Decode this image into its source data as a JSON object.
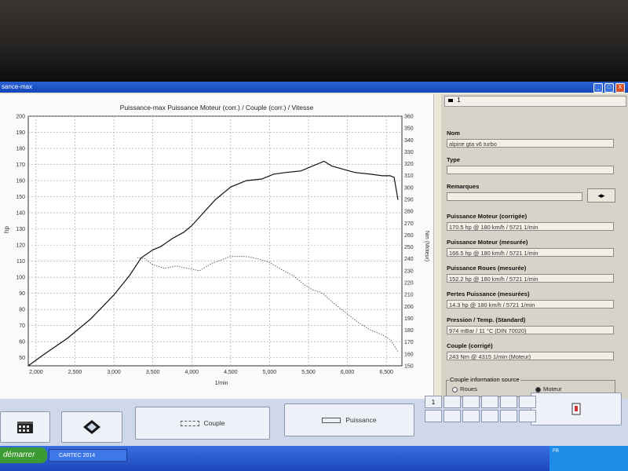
{
  "window": {
    "title": "sance-max",
    "min": "_",
    "max": "□",
    "close": "X"
  },
  "chart_data": {
    "type": "line",
    "title": "Puissance-max Puissance Moteur (corr.) / Couple (corr.) / Vitesse",
    "xlabel": "1/min",
    "ylabel": "hp",
    "y2label": "Nm (Moteur)",
    "xlim": [
      1900,
      6700
    ],
    "ylim": [
      45,
      200
    ],
    "y2lim": [
      150,
      360
    ],
    "xticks": [
      2000,
      2500,
      3000,
      3500,
      4000,
      4500,
      5000,
      5500,
      6000,
      6500
    ],
    "xtick_labels": [
      "2,000",
      "2,500",
      "3,000",
      "3,500",
      "4,000",
      "4,500",
      "5,000",
      "5,500",
      "6,000",
      "6,500"
    ],
    "yticks": [
      50,
      60,
      70,
      80,
      90,
      100,
      110,
      120,
      130,
      140,
      150,
      160,
      170,
      180,
      190,
      200
    ],
    "y2ticks": [
      150,
      160,
      170,
      180,
      190,
      200,
      210,
      220,
      230,
      240,
      250,
      260,
      270,
      280,
      290,
      300,
      310,
      320,
      330,
      340,
      350,
      360
    ],
    "grid": true,
    "series": [
      {
        "name": "Puissance",
        "axis": "left",
        "style": "solid",
        "x": [
          1900,
          2100,
          2400,
          2700,
          3000,
          3200,
          3350,
          3500,
          3600,
          3750,
          3900,
          4000,
          4150,
          4300,
          4500,
          4700,
          4900,
          5050,
          5200,
          5400,
          5550,
          5650,
          5700,
          5800,
          5950,
          6100,
          6300,
          6450,
          6550,
          6600,
          6650
        ],
        "y": [
          45,
          52,
          62,
          74,
          89,
          101,
          112,
          117,
          119,
          124,
          128,
          132,
          140,
          148,
          156,
          160,
          161,
          164,
          165,
          166,
          169,
          171,
          172,
          169,
          167,
          165,
          164,
          163,
          163,
          162,
          148
        ]
      },
      {
        "name": "Couple",
        "axis": "right",
        "style": "dotted",
        "x": [
          3300,
          3400,
          3500,
          3650,
          3800,
          3950,
          4100,
          4250,
          4500,
          4700,
          4850,
          5000,
          5150,
          5300,
          5450,
          5550,
          5650,
          5700,
          5800,
          5950,
          6150,
          6300,
          6450,
          6550,
          6650
        ],
        "y": [
          241,
          240,
          235,
          232,
          234,
          232,
          230,
          236,
          242,
          242,
          240,
          237,
          231,
          226,
          218,
          214,
          212,
          210,
          204,
          196,
          186,
          180,
          176,
          172,
          162
        ]
      }
    ]
  },
  "right_panel": {
    "tab": "1",
    "nom_label": "Nom",
    "nom_value": "alpine gta v6 turbo",
    "type_label": "Type",
    "type_value": "",
    "remarques_label": "Remarques",
    "remarques_value": "",
    "arrow_button": "◂▸",
    "pm_corr_label": "Puissance Moteur (corrigée)",
    "pm_corr_value": "170.5 hp @ 180 km/h / 5721 1/min",
    "pm_mes_label": "Puissance Moteur (mesurée)",
    "pm_mes_value": "166.5 hp @ 180 km/h / 5721 1/min",
    "pr_mes_label": "Puissance Roues (mesurée)",
    "pr_mes_value": "152.2 hp @ 180 km/h / 5721 1/min",
    "pertes_label": "Pertes Puissance (mesurées)",
    "pertes_value": "14.3 hp @ 180 km/h / 5721 1/min",
    "pression_label": "Pression / Temp. (Standard)",
    "pression_value": "974 mBar / 11 °C (DIN 70020)",
    "couple_label": "Couple (corrigé)",
    "couple_value": "243 Nm @ 4315 1/min (Moteur)",
    "source_group_label": "Couple information source",
    "radio_roues": "Roues",
    "radio_moteur": "Moteur"
  },
  "bottom": {
    "couple_button": "Couple",
    "puissance_button": "Puissance",
    "keypad_first": "1"
  },
  "taskbar": {
    "start": "démarrer",
    "task": "CARTEC 2014",
    "tray_lang": "FR"
  }
}
